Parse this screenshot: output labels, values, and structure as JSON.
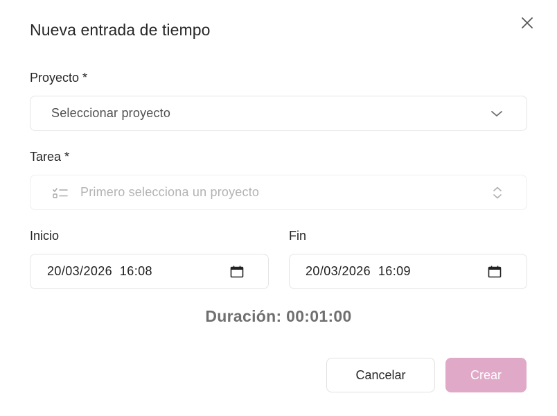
{
  "dialog": {
    "title": "Nueva entrada de tiempo",
    "close_icon": "close-icon"
  },
  "project": {
    "label": "Proyecto *",
    "value": "Seleccionar proyecto",
    "icon": "chevron-down-icon"
  },
  "task": {
    "label": "Tarea *",
    "placeholder": "Primero selecciona un proyecto",
    "leading_icon": "task-list-icon",
    "trailing_icon": "chevron-up-down-icon",
    "disabled": true
  },
  "start": {
    "label": "Inicio",
    "value": "20/03/2026  16:08",
    "icon": "calendar-icon"
  },
  "end": {
    "label": "Fin",
    "value": "20/03/2026  16:09",
    "icon": "calendar-icon"
  },
  "duration": {
    "text": "Duración: 00:01:00"
  },
  "actions": {
    "cancel_label": "Cancelar",
    "create_label": "Crear",
    "create_color": "#e0a9c8"
  }
}
